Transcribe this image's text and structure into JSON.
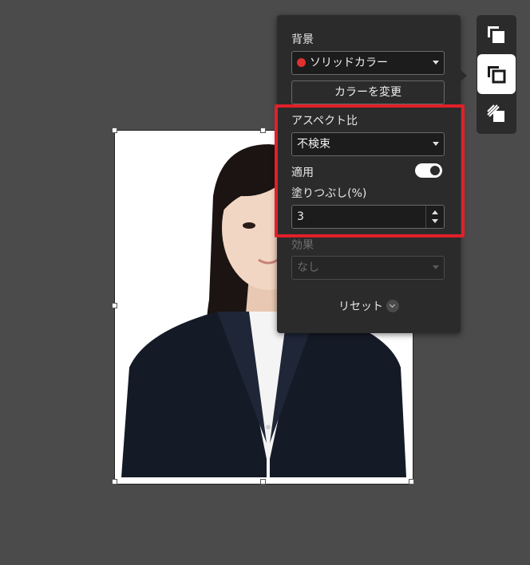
{
  "panel": {
    "background_label": "背景",
    "background_type": {
      "selected": "ソリッドカラー",
      "color": "#e03131"
    },
    "change_color_button": "カラーを変更",
    "aspect_ratio_label": "アスペクト比",
    "aspect_ratio_select": {
      "selected": "不検束"
    },
    "apply_label": "適用",
    "apply_toggle_on": true,
    "fill_label": "塗りつぶし(%)",
    "fill_value": "3",
    "effect_label": "効果",
    "effect_select": {
      "selected": "なし"
    },
    "reset_label": "リセット"
  },
  "toolbar": {
    "tools": [
      {
        "icon": "copy-layers-icon",
        "active": false
      },
      {
        "icon": "layers-front-icon",
        "active": true
      },
      {
        "icon": "hatched-layers-icon",
        "active": false
      }
    ]
  },
  "colors": {
    "highlight": "#e0202a",
    "accent_dot": "#e03131",
    "panel_bg": "#2b2b2b"
  }
}
